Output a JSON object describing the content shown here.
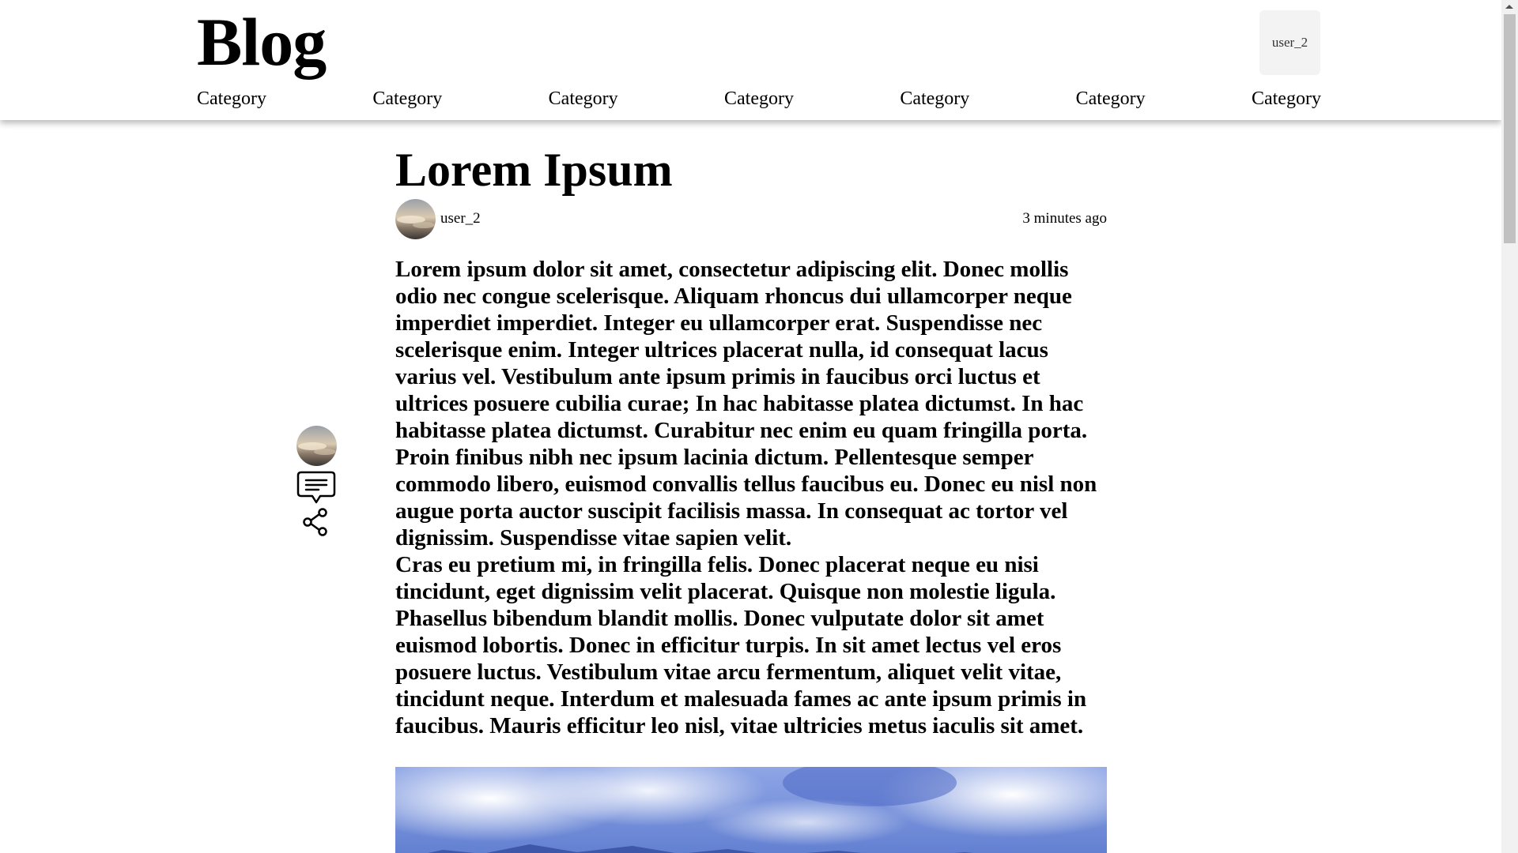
{
  "header": {
    "logo": "Blog",
    "user_label": "user_2",
    "nav": [
      "Category",
      "Category",
      "Category",
      "Category",
      "Category",
      "Category",
      "Category"
    ]
  },
  "article": {
    "title": "Lorem Ipsum",
    "author": "user_2",
    "time": "3 minutes ago",
    "paragraphs": [
      "Lorem ipsum dolor sit amet, consectetur adipiscing elit. Donec mollis odio nec congue scelerisque. Aliquam rhoncus dui ullamcorper neque imperdiet imperdiet. Integer eu ullamcorper erat. Suspendisse nec scelerisque enim. Integer ultrices placerat nulla, id consequat lacus varius vel. Vestibulum ante ipsum primis in faucibus orci luctus et ultrices posuere cubilia curae; In hac habitasse platea dictumst. In hac habitasse platea dictumst. Curabitur nec enim eu quam fringilla porta. Proin finibus nibh nec ipsum lacinia dictum. Pellentesque semper commodo libero, euismod convallis tellus faucibus eu. Donec eu nisl non augue porta auctor suscipit facilisis massa. In consequat ac tortor vel dignissim. Suspendisse vitae sapien velit.",
      "Cras eu pretium mi, in fringilla felis. Donec placerat neque eu nisi tincidunt, eget dignissim velit placerat. Quisque non molestie ligula. Phasellus bibendum blandit mollis. Donec vulputate dolor sit amet euismod lobortis. Donec in efficitur turpis. In sit amet lectus vel eros posuere luctus. Vestibulum vitae arcu fermentum, aliquet velit vitae, tincidunt neque. Interdum et malesuada fames ac ante ipsum primis in faucibus. Mauris efficitur leo nisl, vitae ultricies metus iaculis sit amet."
    ]
  },
  "side_rail": {
    "icons": [
      "avatar",
      "comment-icon",
      "share-icon"
    ]
  },
  "colors": {
    "header_bg": "#ffffff",
    "user_box_bg": "#f3f3f3",
    "sky_blue": "#6f8fd8"
  }
}
